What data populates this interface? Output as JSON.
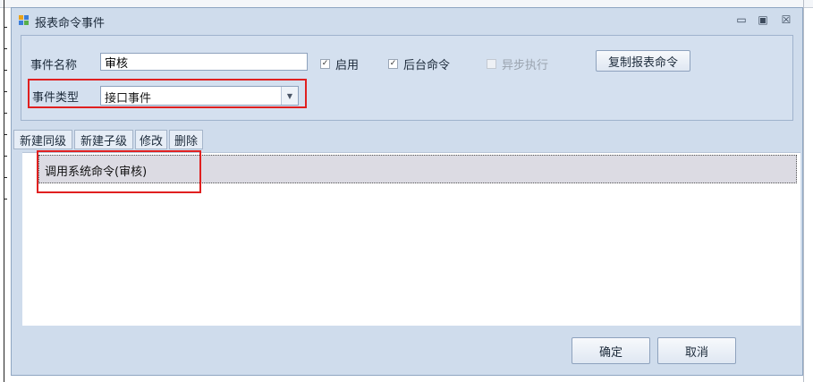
{
  "dialog": {
    "title": "报表命令事件"
  },
  "form": {
    "event_name_label": "事件名称",
    "event_name_value": "审核",
    "enable_label": "启用",
    "enable_checked": true,
    "background_label": "后台命令",
    "background_checked": true,
    "async_label": "异步执行",
    "async_checked": false,
    "copy_button": "复制报表命令",
    "event_type_label": "事件类型",
    "event_type_value": "接口事件"
  },
  "toolbar": {
    "new_sibling": "新建同级",
    "new_child": "新建子级",
    "edit": "修改",
    "delete": "删除"
  },
  "tree": {
    "items": [
      {
        "label": "调用系统命令(审核)"
      }
    ]
  },
  "footer": {
    "ok": "确定",
    "cancel": "取消"
  },
  "colors": {
    "highlight": "#e02020",
    "dialog_bg": "#cfdcec"
  }
}
